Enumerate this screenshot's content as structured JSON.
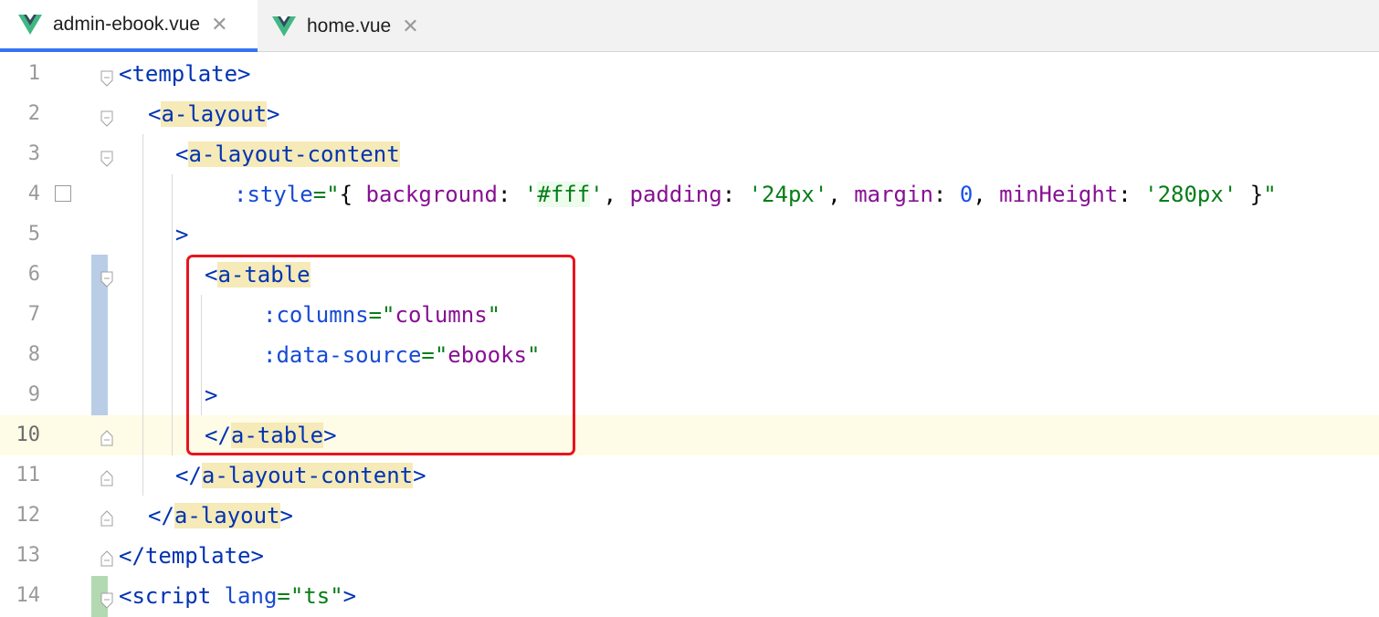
{
  "tabs": [
    {
      "label": "admin-ebook.vue",
      "active": true,
      "icon": "vue-icon"
    },
    {
      "label": "home.vue",
      "active": false,
      "icon": "vue-icon"
    }
  ],
  "colors": {
    "tag": "#0033b3",
    "attribute": "#174ad4",
    "string": "#067d17",
    "property": "#871094",
    "number": "#1750eb",
    "highlight_border": "#e8141f",
    "current_line": "#fefbe7",
    "tag_match_bg": "#f5eab8"
  },
  "lines": [
    {
      "number": "1"
    },
    {
      "number": "2"
    },
    {
      "number": "3"
    },
    {
      "number": "4"
    },
    {
      "number": "5"
    },
    {
      "number": "6"
    },
    {
      "number": "7"
    },
    {
      "number": "8"
    },
    {
      "number": "9"
    },
    {
      "number": "10"
    },
    {
      "number": "11"
    },
    {
      "number": "12"
    },
    {
      "number": "13"
    },
    {
      "number": "14"
    }
  ],
  "code": {
    "l1": {
      "open": "<",
      "name": "template",
      "close": ">"
    },
    "l2": {
      "open": "<",
      "name": "a-layout",
      "close": ">"
    },
    "l3": {
      "open": "<",
      "name": "a-layout-content"
    },
    "l4": {
      "attr": ":style",
      "eq": "=\"",
      "brace_open": "{ ",
      "k1": "background",
      "c1": ": ",
      "q1o": "'",
      "v1": "#fff",
      "q1c": "'",
      "s1": ", ",
      "k2": "padding",
      "c2": ": ",
      "v2": "'24px'",
      "s2": ", ",
      "k3": "margin",
      "c3": ": ",
      "v3": "0",
      "s3": ", ",
      "k4": "minHeight",
      "c4": ": ",
      "v4": "'280px'",
      "brace_close": " }",
      "endq": "\""
    },
    "l5": {
      "close": ">"
    },
    "l6": {
      "open": "<",
      "name": "a-table"
    },
    "l7": {
      "attr": ":columns",
      "eq": "=\"",
      "value": "columns",
      "endq": "\""
    },
    "l8": {
      "attr": ":data-source",
      "eq": "=\"",
      "value": "ebooks",
      "endq": "\""
    },
    "l9": {
      "close": ">"
    },
    "l10": {
      "open": "</",
      "name": "a-table",
      "close": ">"
    },
    "l11": {
      "open": "</",
      "name": "a-layout-content",
      "close": ">"
    },
    "l12": {
      "open": "</",
      "name": "a-layout",
      "close": ">"
    },
    "l13": {
      "open": "</",
      "name": "template",
      "close": ">"
    },
    "l14": {
      "open": "<",
      "name": "script",
      "sp": " ",
      "attr": "lang",
      "eq": "=\"",
      "value": "ts",
      "endq": "\"",
      "close": ">"
    }
  }
}
